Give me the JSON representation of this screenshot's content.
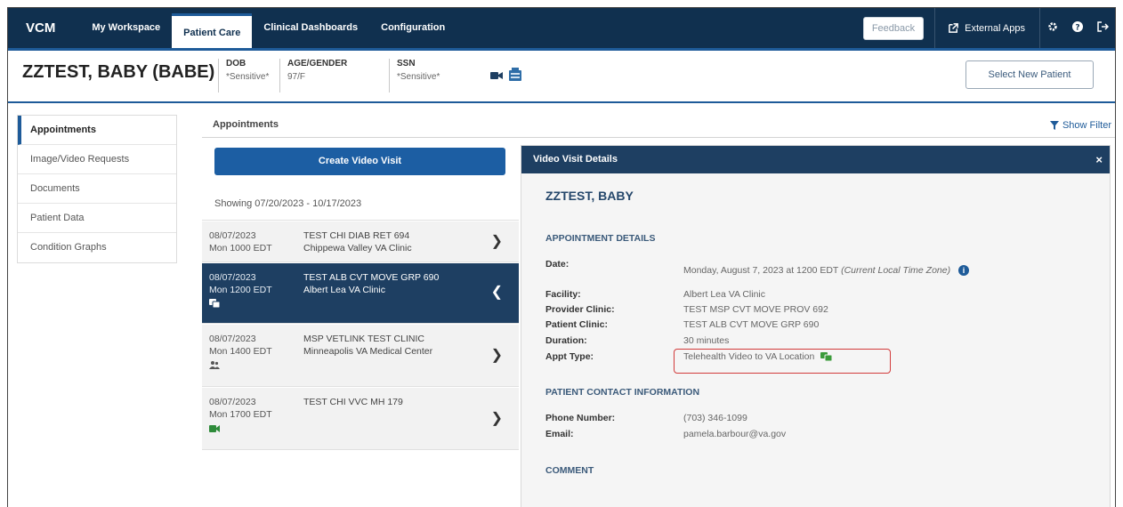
{
  "nav": {
    "brand": "VCM",
    "tabs": [
      "My Workspace",
      "Patient Care",
      "Clinical Dashboards",
      "Configuration"
    ],
    "active_tab": "Patient Care",
    "feedback": "Feedback",
    "external_apps": "External Apps",
    "icons": [
      "gear-icon",
      "help-icon",
      "logout-icon"
    ]
  },
  "patient": {
    "name": "ZZTEST, BABY (BABE)",
    "fields": [
      {
        "label": "DOB",
        "value": "*Sensitive*"
      },
      {
        "label": "AGE/GENDER",
        "value": "97/F"
      },
      {
        "label": "SSN",
        "value": "*Sensitive*"
      }
    ],
    "select_new": "Select New Patient"
  },
  "sidebar": {
    "items": [
      {
        "label": "Appointments",
        "active": true
      },
      {
        "label": "Image/Video Requests"
      },
      {
        "label": "Documents"
      },
      {
        "label": "Patient Data"
      },
      {
        "label": "Condition Graphs"
      }
    ]
  },
  "main": {
    "title": "Appointments",
    "show_filter": "Show Filter",
    "create_btn": "Create Video Visit",
    "showing": "Showing 07/20/2023 - 10/17/2023",
    "appointments": [
      {
        "date": "08/07/2023",
        "time": "Mon 1000 EDT",
        "clinic": "TEST CHI DIAB RET 694",
        "location": "Chippewa Valley VA Clinic",
        "icon": ""
      },
      {
        "date": "08/07/2023",
        "time": "Mon 1200 EDT",
        "clinic": "TEST ALB CVT MOVE GRP 690",
        "location": "Albert Lea VA Clinic",
        "icon": "telehealth-to-va-icon"
      },
      {
        "date": "08/07/2023",
        "time": "Mon 1400 EDT",
        "clinic": "MSP VETLINK TEST CLINIC",
        "location": "Minneapolis VA Medical Center",
        "icon": "in-person-icon"
      },
      {
        "date": "08/07/2023",
        "time": "Mon 1700 EDT",
        "clinic": "TEST CHI VVC MH 179",
        "location": "",
        "icon": "video-camera-icon"
      }
    ]
  },
  "detail": {
    "header": "Video Visit Details",
    "close": "×",
    "name": "ZZTEST, BABY",
    "appt_section": "APPOINTMENT DETAILS",
    "date_label": "Date:",
    "date_value": "Monday, August 7, 2023 at 1200 EDT",
    "date_tz": "(Current Local Time Zone)",
    "facility_label": "Facility:",
    "facility_value": "Albert Lea VA Clinic",
    "provider_label": "Provider Clinic:",
    "provider_value": "TEST MSP CVT MOVE PROV 692",
    "patient_clinic_label": "Patient Clinic:",
    "patient_clinic_value": "TEST ALB CVT MOVE GRP 690",
    "duration_label": "Duration:",
    "duration_value": "30 minutes",
    "type_label": "Appt Type:",
    "type_value": "Telehealth Video to VA Location",
    "contact_section": "PATIENT CONTACT INFORMATION",
    "phone_label": "Phone Number:",
    "phone_value": "(703) 346-1099",
    "email_label": "Email:",
    "email_value": "pamela.barbour@va.gov",
    "comment_section": "COMMENT"
  },
  "colors": {
    "nav_bg": "#10304f",
    "accent": "#1e5b99",
    "selected_row": "#1e3f62",
    "highlight_box": "#d23b3b",
    "telehealth_icon": "#3a9b3a"
  }
}
